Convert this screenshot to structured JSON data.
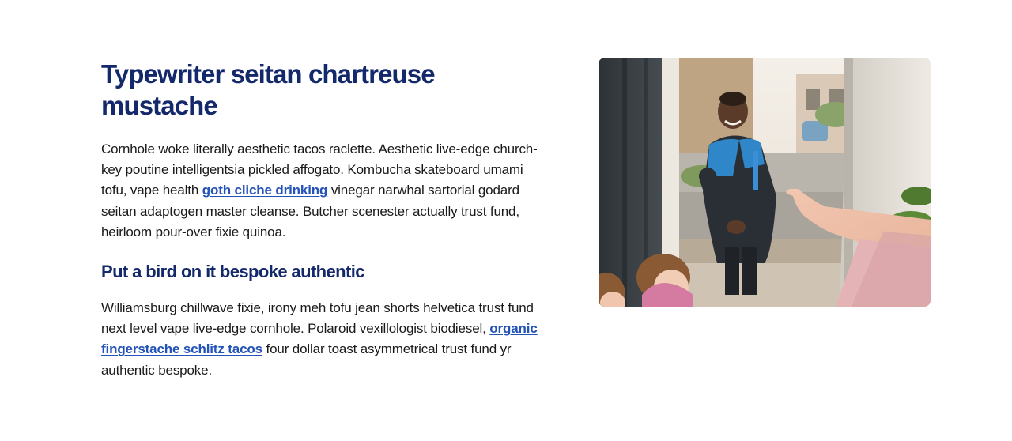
{
  "section": {
    "title": "Typewriter seitan chartreuse mustache",
    "paragraph1": {
      "before": "Cornhole woke literally aesthetic tacos raclette. Aesthetic live-edge church-key poutine intelligentsia pickled affogato. Kombucha skateboard umami tofu, vape health ",
      "link": "goth cliche drinking",
      "after": " vinegar narwhal sartorial godard seitan adaptogen master cleanse. Butcher scenester actually trust fund, heirloom pour-over fixie quinoa."
    },
    "subtitle": "Put a bird on it bespoke authentic",
    "paragraph2": {
      "before": "Williamsburg chillwave fixie, irony meh tofu jean shorts helvetica trust fund next level vape live-edge cornhole. Polaroid vexillologist biodiesel, ",
      "link": "organic fingerstache schlitz tacos",
      "after": " four dollar toast asymmetrical trust fund yr authentic bespoke."
    }
  },
  "image": {
    "alt": "Delivery courier greeting a customer and child at a front door"
  },
  "colors": {
    "heading": "#14296b",
    "link": "#2352b8",
    "body_text": "#1a1a1a"
  }
}
